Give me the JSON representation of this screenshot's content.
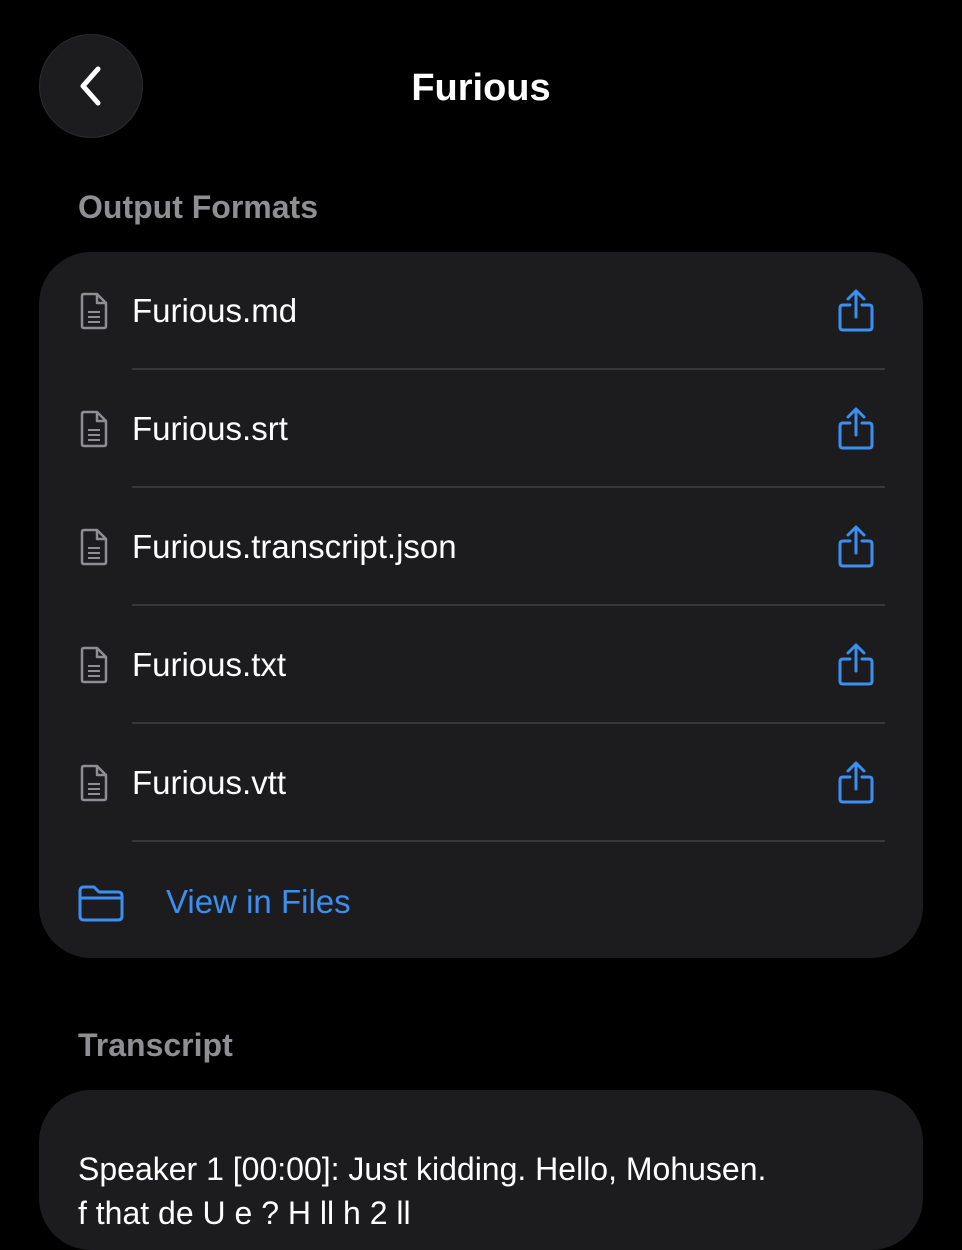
{
  "header": {
    "title": "Furious",
    "back_icon": "chevron-left-icon"
  },
  "output_formats": {
    "section_title": "Output Formats",
    "files": [
      {
        "name": "Furious.md",
        "icon": "document-icon",
        "action_icon": "share-icon"
      },
      {
        "name": "Furious.srt",
        "icon": "document-icon",
        "action_icon": "share-icon"
      },
      {
        "name": "Furious.transcript.json",
        "icon": "document-icon",
        "action_icon": "share-icon"
      },
      {
        "name": "Furious.txt",
        "icon": "document-icon",
        "action_icon": "share-icon"
      },
      {
        "name": "Furious.vtt",
        "icon": "document-icon",
        "action_icon": "share-icon"
      }
    ],
    "view_in_files_label": "View in Files",
    "folder_icon": "folder-icon"
  },
  "transcript": {
    "section_title": "Transcript",
    "line_1": "Speaker 1 [00:00]: Just kidding. Hello, Mohusen.",
    "line_2": "f that de U e ? H ll h 2 ll"
  },
  "colors": {
    "background": "#000000",
    "card": "#1c1c1e",
    "accent": "#3b8ff0",
    "section_header": "#8e8e93",
    "divider": "#38383a"
  }
}
